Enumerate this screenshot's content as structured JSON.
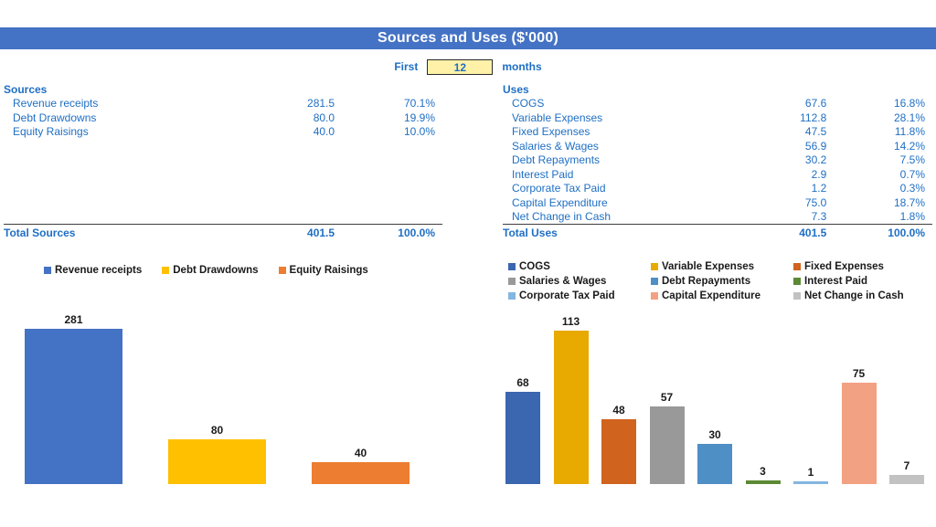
{
  "header": {
    "title": "Sources and Uses ($'000)",
    "bar_color": "#4472C4"
  },
  "period": {
    "prefix_label": "First",
    "value": "12",
    "suffix_label": "months",
    "input_bg": "#FFF2A8"
  },
  "sources": {
    "section_title": "Sources",
    "rows": [
      {
        "label": "Revenue receipts",
        "value": "281.5",
        "pct": "70.1%"
      },
      {
        "label": "Debt Drawdowns",
        "value": "80.0",
        "pct": "19.9%"
      },
      {
        "label": "Equity Raisings",
        "value": "40.0",
        "pct": "10.0%"
      }
    ],
    "total": {
      "label": "Total Sources",
      "value": "401.5",
      "pct": "100.0%"
    }
  },
  "uses": {
    "section_title": "Uses",
    "rows": [
      {
        "label": "COGS",
        "value": "67.6",
        "pct": "16.8%"
      },
      {
        "label": "Variable Expenses",
        "value": "112.8",
        "pct": "28.1%"
      },
      {
        "label": "Fixed Expenses",
        "value": "47.5",
        "pct": "11.8%"
      },
      {
        "label": "Salaries & Wages",
        "value": "56.9",
        "pct": "14.2%"
      },
      {
        "label": "Debt Repayments",
        "value": "30.2",
        "pct": "7.5%"
      },
      {
        "label": "Interest Paid",
        "value": "2.9",
        "pct": "0.7%"
      },
      {
        "label": "Corporate Tax Paid",
        "value": "1.2",
        "pct": "0.3%"
      },
      {
        "label": "Capital Expenditure",
        "value": "75.0",
        "pct": "18.7%"
      },
      {
        "label": "Net Change in Cash",
        "value": "7.3",
        "pct": "1.8%"
      }
    ],
    "total": {
      "label": "Total Uses",
      "value": "401.5",
      "pct": "100.0%"
    }
  },
  "chart_data": [
    {
      "id": "sources-chart",
      "type": "bar",
      "title": "",
      "xlabel": "",
      "ylabel": "",
      "ylim": [
        0,
        300
      ],
      "grid": false,
      "legend_position": "top",
      "categories": [
        "Revenue receipts",
        "Debt Drawdowns",
        "Equity Raisings"
      ],
      "values": [
        281,
        80,
        40
      ],
      "data_labels": [
        "281",
        "80",
        "40"
      ],
      "colors": [
        "#4472C4",
        "#FFC000",
        "#ED7D31"
      ]
    },
    {
      "id": "uses-chart",
      "type": "bar",
      "title": "",
      "xlabel": "",
      "ylabel": "",
      "ylim": [
        0,
        120
      ],
      "grid": false,
      "legend_position": "top",
      "categories": [
        "COGS",
        "Variable Expenses",
        "Fixed Expenses",
        "Salaries & Wages",
        "Debt Repayments",
        "Interest Paid",
        "Corporate Tax Paid",
        "Capital Expenditure",
        "Net Change in Cash"
      ],
      "values": [
        68,
        113,
        48,
        57,
        30,
        3,
        1,
        75,
        7
      ],
      "data_labels": [
        "68",
        "113",
        "48",
        "57",
        "30",
        "3",
        "1",
        "75",
        "7"
      ],
      "colors": [
        "#3B66B0",
        "#E8A900",
        "#D0631E",
        "#999999",
        "#4E8FC6",
        "#5C8A34",
        "#84B6E0",
        "#F3A183",
        "#C2C2C2"
      ]
    }
  ]
}
